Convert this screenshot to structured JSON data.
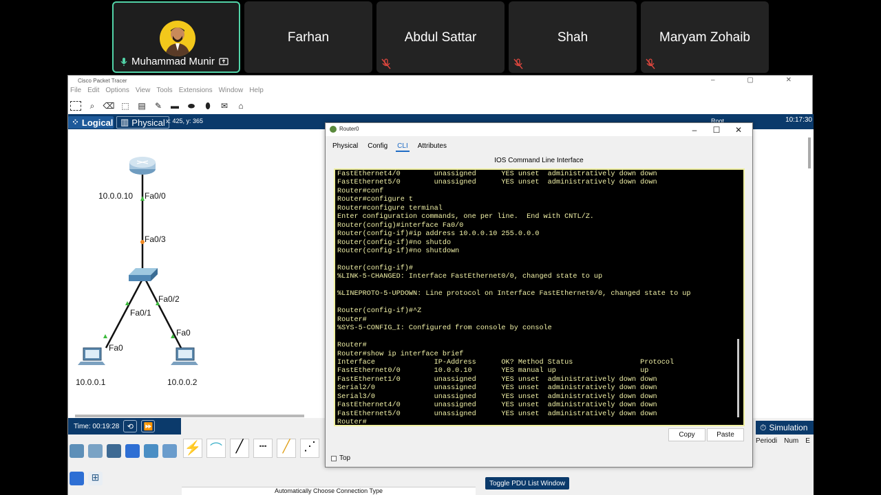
{
  "meeting": {
    "participants": [
      {
        "name": "Muhammad Munir",
        "active": true
      },
      {
        "name": "Farhan"
      },
      {
        "name": "Abdul Sattar",
        "muted": true
      },
      {
        "name": "Shah",
        "muted": true
      },
      {
        "name": "Maryam Zohaib",
        "muted": true
      }
    ]
  },
  "app": {
    "title": "Cisco Packet Tracer",
    "menu": [
      "File",
      "Edit",
      "Options",
      "View",
      "Tools",
      "Extensions",
      "Window",
      "Help"
    ],
    "tabs": {
      "logical": "Logical",
      "physical": "Physical"
    },
    "coords": "x: 425, y: 365",
    "root": "Root",
    "clock": "10:17:30",
    "time": "Time: 00:19:28",
    "connection_hint": "Automatically Choose Connection Type",
    "pdu_button": "Toggle PDU List Window",
    "simulation_label": "Simulation",
    "pdu_columns": [
      "Periodi",
      "Num",
      "E"
    ]
  },
  "topology": {
    "router_ip": "10.0.0.10",
    "router_port": "Fa0/0",
    "switch_up_port": "Fa0/3",
    "switch_left_port": "Fa0/1",
    "switch_right_port": "Fa0/2",
    "pc_left_port": "Fa0",
    "pc_right_port": "Fa0",
    "pc_left_ip": "10.0.0.1",
    "pc_right_ip": "10.0.0.2"
  },
  "dialog": {
    "title": "Router0",
    "tabs": [
      "Physical",
      "Config",
      "CLI",
      "Attributes"
    ],
    "active_tab": "CLI",
    "heading": "IOS Command Line Interface",
    "copy": "Copy",
    "paste": "Paste",
    "top_checkbox": "Top",
    "terminal_lines": [
      "FastEthernet4/0        unassigned      YES unset  administratively down down",
      "FastEthernet5/0        unassigned      YES unset  administratively down down",
      "Router#conf",
      "Router#configure t",
      "Router#configure terminal",
      "Enter configuration commands, one per line.  End with CNTL/Z.",
      "Router(config)#interface Fa0/0",
      "Router(config-if)#ip address 10.0.0.10 255.0.0.0",
      "Router(config-if)#no shutdo",
      "Router(config-if)#no shutdown",
      "",
      "Router(config-if)#",
      "%LINK-5-CHANGED: Interface FastEthernet0/0, changed state to up",
      "",
      "%LINEPROTO-5-UPDOWN: Line protocol on Interface FastEthernet0/0, changed state to up",
      "",
      "Router(config-if)#^Z",
      "Router#",
      "%SYS-5-CONFIG_I: Configured from console by console",
      "",
      "Router#",
      "Router#show ip interface brief",
      "Interface              IP-Address      OK? Method Status                Protocol",
      "FastEthernet0/0        10.0.0.10       YES manual up                    up",
      "FastEthernet1/0        unassigned      YES unset  administratively down down",
      "Serial2/0              unassigned      YES unset  administratively down down",
      "Serial3/0              unassigned      YES unset  administratively down down",
      "FastEthernet4/0        unassigned      YES unset  administratively down down",
      "FastEthernet5/0        unassigned      YES unset  administratively down down",
      "Router#"
    ]
  }
}
